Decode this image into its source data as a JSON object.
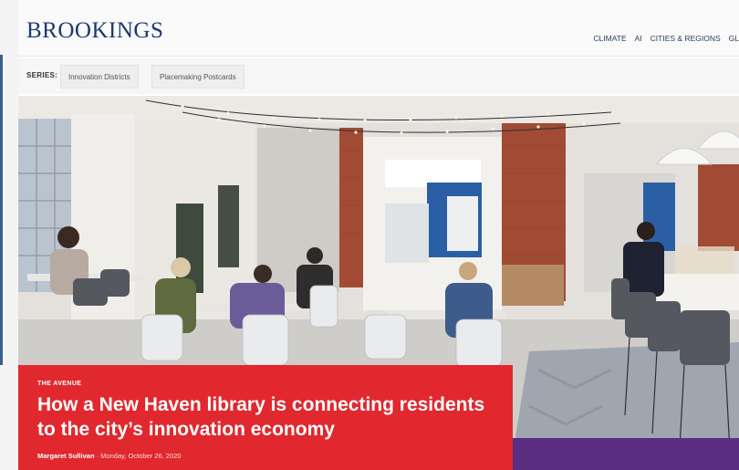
{
  "brand": {
    "logo": "BROOKINGS",
    "color": "#1b3a6b"
  },
  "topnav": {
    "items": [
      "CLIMATE",
      "AI",
      "CITIES & REGIONS",
      "GL"
    ]
  },
  "series": {
    "label": "SERIES:",
    "chips": [
      "Innovation Districts",
      "Placemaking Postcards"
    ]
  },
  "article": {
    "kicker": "THE AVENUE",
    "headline": "How a New Haven library is connecting residents to the city’s innovation economy",
    "author": "Margaret Sullivan",
    "separator": "·",
    "date": "Monday, October 26, 2020",
    "card_color": "#e0282e"
  },
  "colors": {
    "accent_purple": "#5a2d82",
    "brick": "#a14b34"
  }
}
